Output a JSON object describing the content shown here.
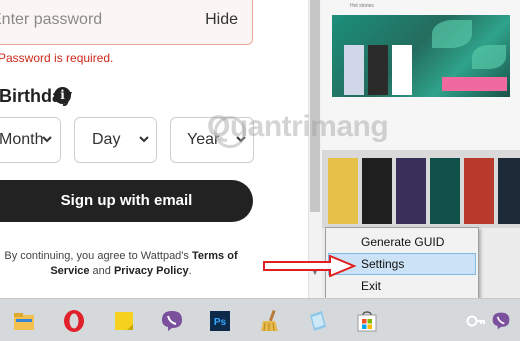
{
  "signup": {
    "password_placeholder": "Enter password",
    "hide_label": "Hide",
    "password_error": "Password is required.",
    "birthday_label": "Birthday",
    "info_icon_glyph": "i",
    "month_value": "Month",
    "day_value": "Day",
    "year_value": "Year",
    "signup_button": "Sign up with email",
    "terms_prefix": "By continuing, you agree to Wattpad's ",
    "terms_link": "Terms of Service",
    "terms_and": " and ",
    "privacy_link": "Privacy Policy",
    "terms_suffix": "."
  },
  "background": {
    "watermark_text": "Quantrimang",
    "small_text": "Hot stories"
  },
  "context_menu": {
    "items": [
      {
        "label": "Generate GUID",
        "highlighted": false
      },
      {
        "label": "Settings",
        "highlighted": true
      },
      {
        "label": "Exit",
        "highlighted": false
      }
    ]
  },
  "taskbar": {
    "icons": [
      "file-explorer-icon",
      "opera-browser-icon",
      "sticky-notes-icon",
      "viber-icon",
      "photoshop-icon",
      "ccleaner-broom-icon",
      "notebook-app-icon",
      "microsoft-store-icon",
      "key-tray-icon",
      "viber-tray-icon"
    ],
    "photoshop_text": "Ps"
  },
  "colors": {
    "error_red": "#d0291c",
    "button_dark": "#222222",
    "menu_highlight": "#cce3f7",
    "arrow_red": "#e02020",
    "taskbar_bg": "#d6d9dc"
  }
}
